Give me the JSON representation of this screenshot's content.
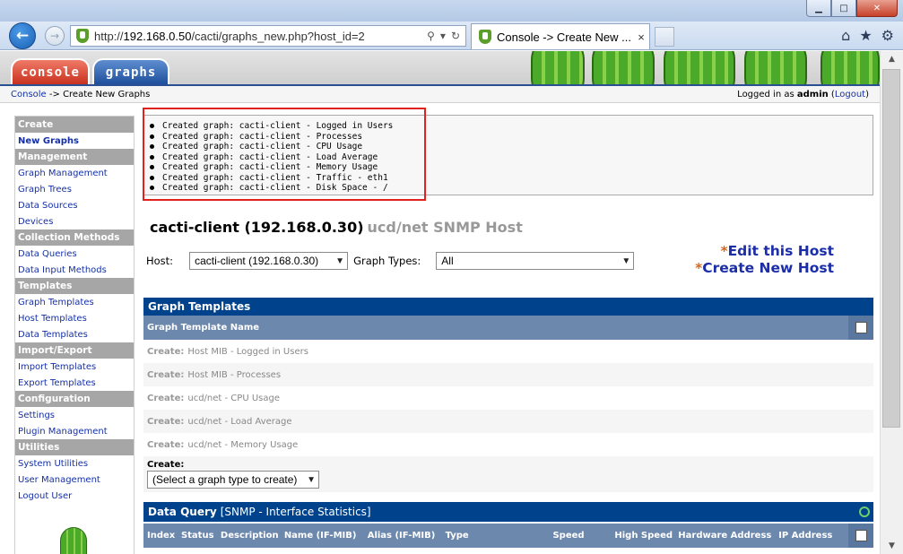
{
  "browser": {
    "url_prefix": "http://",
    "url_host": "192.168.0.50",
    "url_path": "/cacti/graphs_new.php?host_id=2",
    "tab_title": "Console -> Create New ...",
    "tab_close": "×"
  },
  "nav": {
    "console_label": "console",
    "graphs_label": "graphs"
  },
  "breadcrumb": {
    "console": "Console",
    "separator": " -> ",
    "current": "Create New Graphs",
    "login_prefix": "Logged in as ",
    "user": "admin",
    "logout": "Logout"
  },
  "sidebar": {
    "sections": [
      {
        "title": "Create",
        "items": [
          "New Graphs"
        ]
      },
      {
        "title": "Management",
        "items": [
          "Graph Management",
          "Graph Trees",
          "Data Sources",
          "Devices"
        ]
      },
      {
        "title": "Collection Methods",
        "items": [
          "Data Queries",
          "Data Input Methods"
        ]
      },
      {
        "title": "Templates",
        "items": [
          "Graph Templates",
          "Host Templates",
          "Data Templates"
        ]
      },
      {
        "title": "Import/Export",
        "items": [
          "Import Templates",
          "Export Templates"
        ]
      },
      {
        "title": "Configuration",
        "items": [
          "Settings",
          "Plugin Management"
        ]
      },
      {
        "title": "Utilities",
        "items": [
          "System Utilities",
          "User Management",
          "Logout User"
        ]
      }
    ]
  },
  "messages": [
    "Created graph: cacti-client - Logged in Users",
    "Created graph: cacti-client - Processes",
    "Created graph: cacti-client - CPU Usage",
    "Created graph: cacti-client - Load Average",
    "Created graph: cacti-client - Memory Usage",
    "Created graph: cacti-client - Traffic - eth1",
    "Created graph: cacti-client - Disk Space - /"
  ],
  "host": {
    "title": "cacti-client (192.168.0.30)",
    "type": "ucd/net SNMP Host",
    "host_label": "Host:",
    "host_value": "cacti-client (192.168.0.30)",
    "graph_types_label": "Graph Types:",
    "graph_types_value": "All",
    "edit_link": "Edit this Host",
    "create_link": "Create New Host",
    "asterisk": "*"
  },
  "graph_templates": {
    "title": "Graph Templates",
    "column": "Graph Template Name",
    "create_prefix": "Create:",
    "rows": [
      "Host MIB - Logged in Users",
      "Host MIB - Processes",
      "ucd/net - CPU Usage",
      "ucd/net - Load Average",
      "ucd/net - Memory Usage"
    ],
    "create_label": "Create:",
    "create_select": "(Select a graph type to create)"
  },
  "data_query": {
    "title_prefix": "Data Query",
    "title_name": "[SNMP - Interface Statistics]",
    "columns": [
      "Index",
      "Status",
      "Description",
      "Name (IF-MIB)",
      "Alias (IF-MIB)",
      "Type",
      "Speed",
      "High Speed",
      "Hardware Address",
      "IP Address"
    ]
  }
}
